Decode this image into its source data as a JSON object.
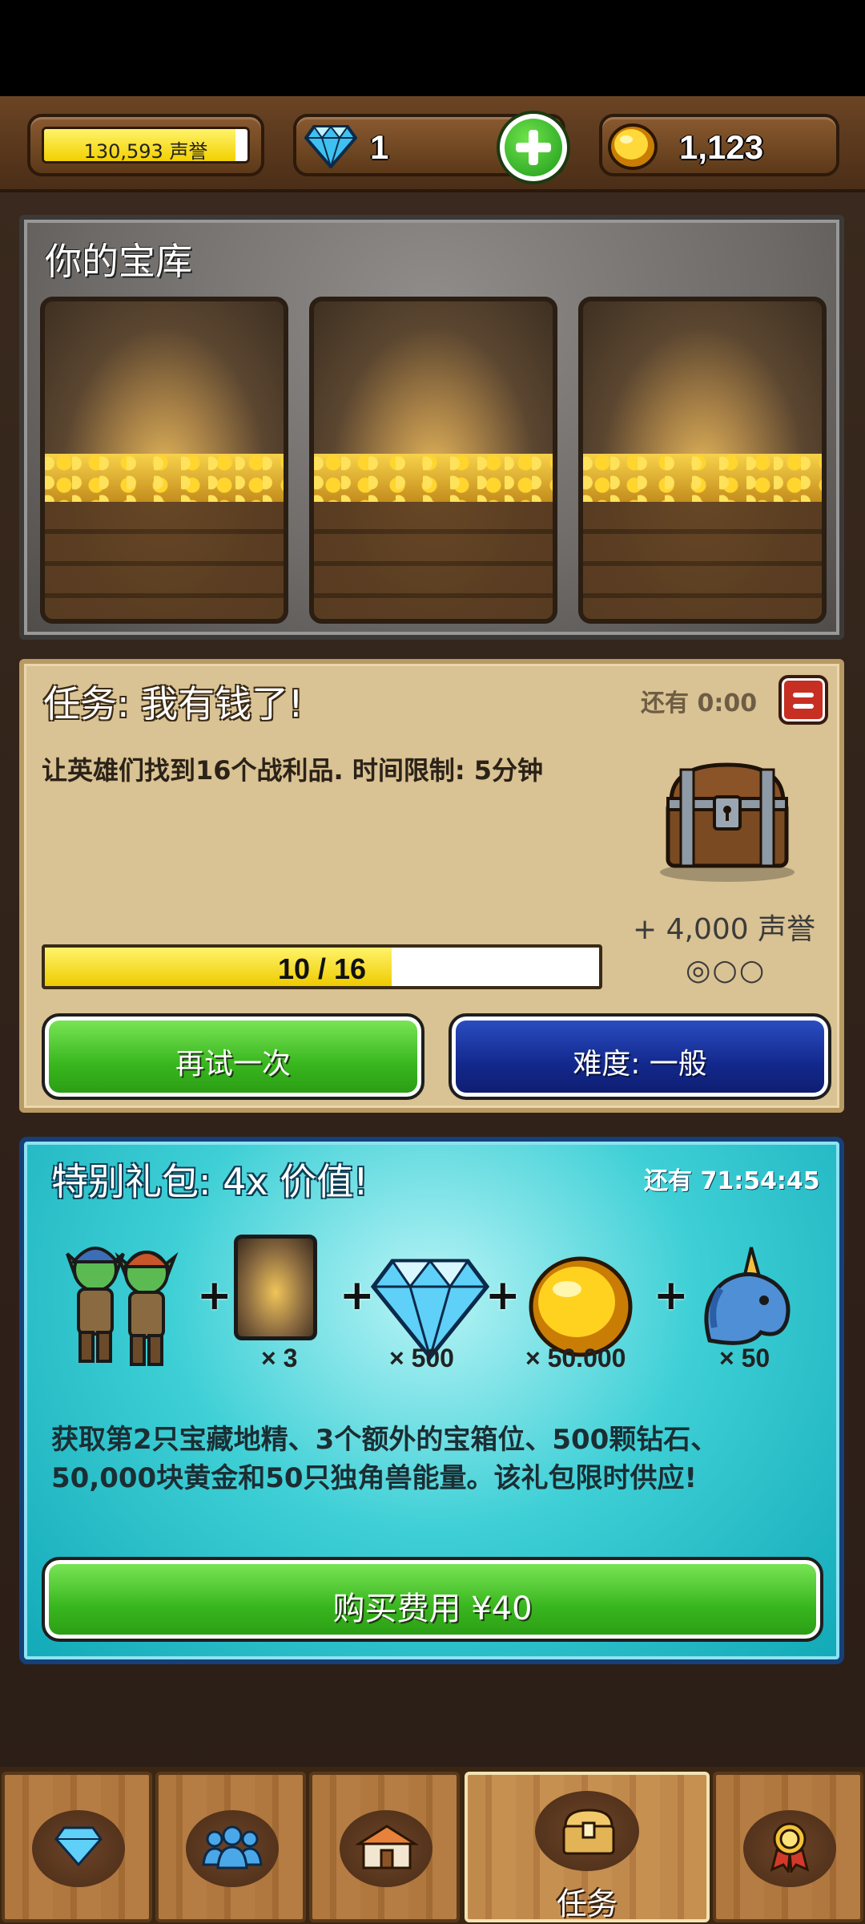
{
  "header": {
    "fame_text": "130,593 声誉",
    "fame_progress": 0.94,
    "gems": "1",
    "gold": "1,123"
  },
  "vault": {
    "title": "你的宝库"
  },
  "quest": {
    "title": "任务: 我有钱了!",
    "time_left": "还有 0:00",
    "description": "让英雄们找到16个战利品. 时间限制: 5分钟",
    "reward": "+ 4,000 声誉",
    "stars": "◎○○",
    "progress_text": "10 / 16",
    "progress_value": 0.625,
    "retry_label": "再试一次",
    "difficulty_label": "难度: 一般"
  },
  "offer": {
    "title": "特别礼包: 4x 价值!",
    "time_left": "还有 71:54:45",
    "items": [
      {
        "icon": "goblin-pair-icon",
        "qty": ""
      },
      {
        "icon": "vault-slot-icon",
        "qty": "× 3"
      },
      {
        "icon": "diamond-icon",
        "qty": "× 500"
      },
      {
        "icon": "gold-coin-icon",
        "qty": "× 50.000"
      },
      {
        "icon": "unicorn-icon",
        "qty": "× 50"
      }
    ],
    "description": "获取第2只宝藏地精、3个额外的宝箱位、500颗钻石、50,000块黄金和50只独角兽能量。该礼包限时供应!",
    "buy_label": "购买费用 ¥40"
  },
  "nav": {
    "tabs": [
      {
        "icon": "diamond-icon",
        "label": ""
      },
      {
        "icon": "heroes-icon",
        "label": ""
      },
      {
        "icon": "buildings-icon",
        "label": ""
      },
      {
        "icon": "treasure-chest-icon",
        "label": "任务"
      },
      {
        "icon": "medal-icon",
        "label": ""
      }
    ],
    "active_index": 3
  },
  "colors": {
    "accent_green": "#38b61e",
    "accent_blue": "#13288c",
    "progress_yellow": "#eecb00",
    "offer_teal": "#3fd0d6"
  }
}
